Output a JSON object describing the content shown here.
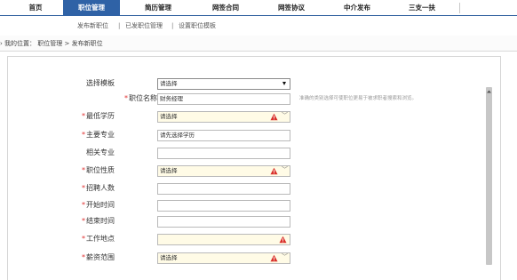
{
  "nav": {
    "items": [
      {
        "label": "首页",
        "active": false
      },
      {
        "label": "职位管理",
        "active": true
      },
      {
        "label": "简历管理",
        "active": false
      },
      {
        "label": "网签合同",
        "active": false
      },
      {
        "label": "网签协议",
        "active": false
      },
      {
        "label": "中介发布",
        "active": false
      },
      {
        "label": "三支一扶",
        "active": false
      }
    ]
  },
  "subnav": {
    "publish": "发布新职位",
    "sep1": "|",
    "published": "已发职位管理",
    "sep2": "|",
    "template": "设置职位模板"
  },
  "breadcrumb": {
    "text": "› 我的位置： 职位管理 > 发布新职位"
  },
  "form": {
    "template": {
      "label": "选择模板",
      "value": "请选择"
    },
    "job_name": {
      "label": "职位名称",
      "value": "财务经理",
      "hint": "准确的类别选择可使职位更易于被求职者搜索和浏览。"
    },
    "education": {
      "label": "最低学历",
      "value": "请选择"
    },
    "major": {
      "label": "主要专业",
      "value": "请先选择学历"
    },
    "related_major": {
      "label": "相关专业",
      "value": ""
    },
    "job_nature": {
      "label": "职位性质",
      "value": "请选择"
    },
    "headcount": {
      "label": "招聘人数",
      "value": ""
    },
    "start_time": {
      "label": "开始时间",
      "value": ""
    },
    "end_time": {
      "label": "结束时间",
      "value": ""
    },
    "location": {
      "label": "工作地点",
      "value": ""
    },
    "salary": {
      "label": "薪资范围",
      "value": "请选择"
    }
  },
  "colors": {
    "nav_active": "#2f62a6",
    "required": "#e03030",
    "warning": "#d9312b",
    "field_highlight": "#fffbe6"
  },
  "icons": {
    "warning": "warning-triangle-icon",
    "chevron": "chevron-down-icon",
    "dropdown": "dropdown-arrow-icon"
  }
}
